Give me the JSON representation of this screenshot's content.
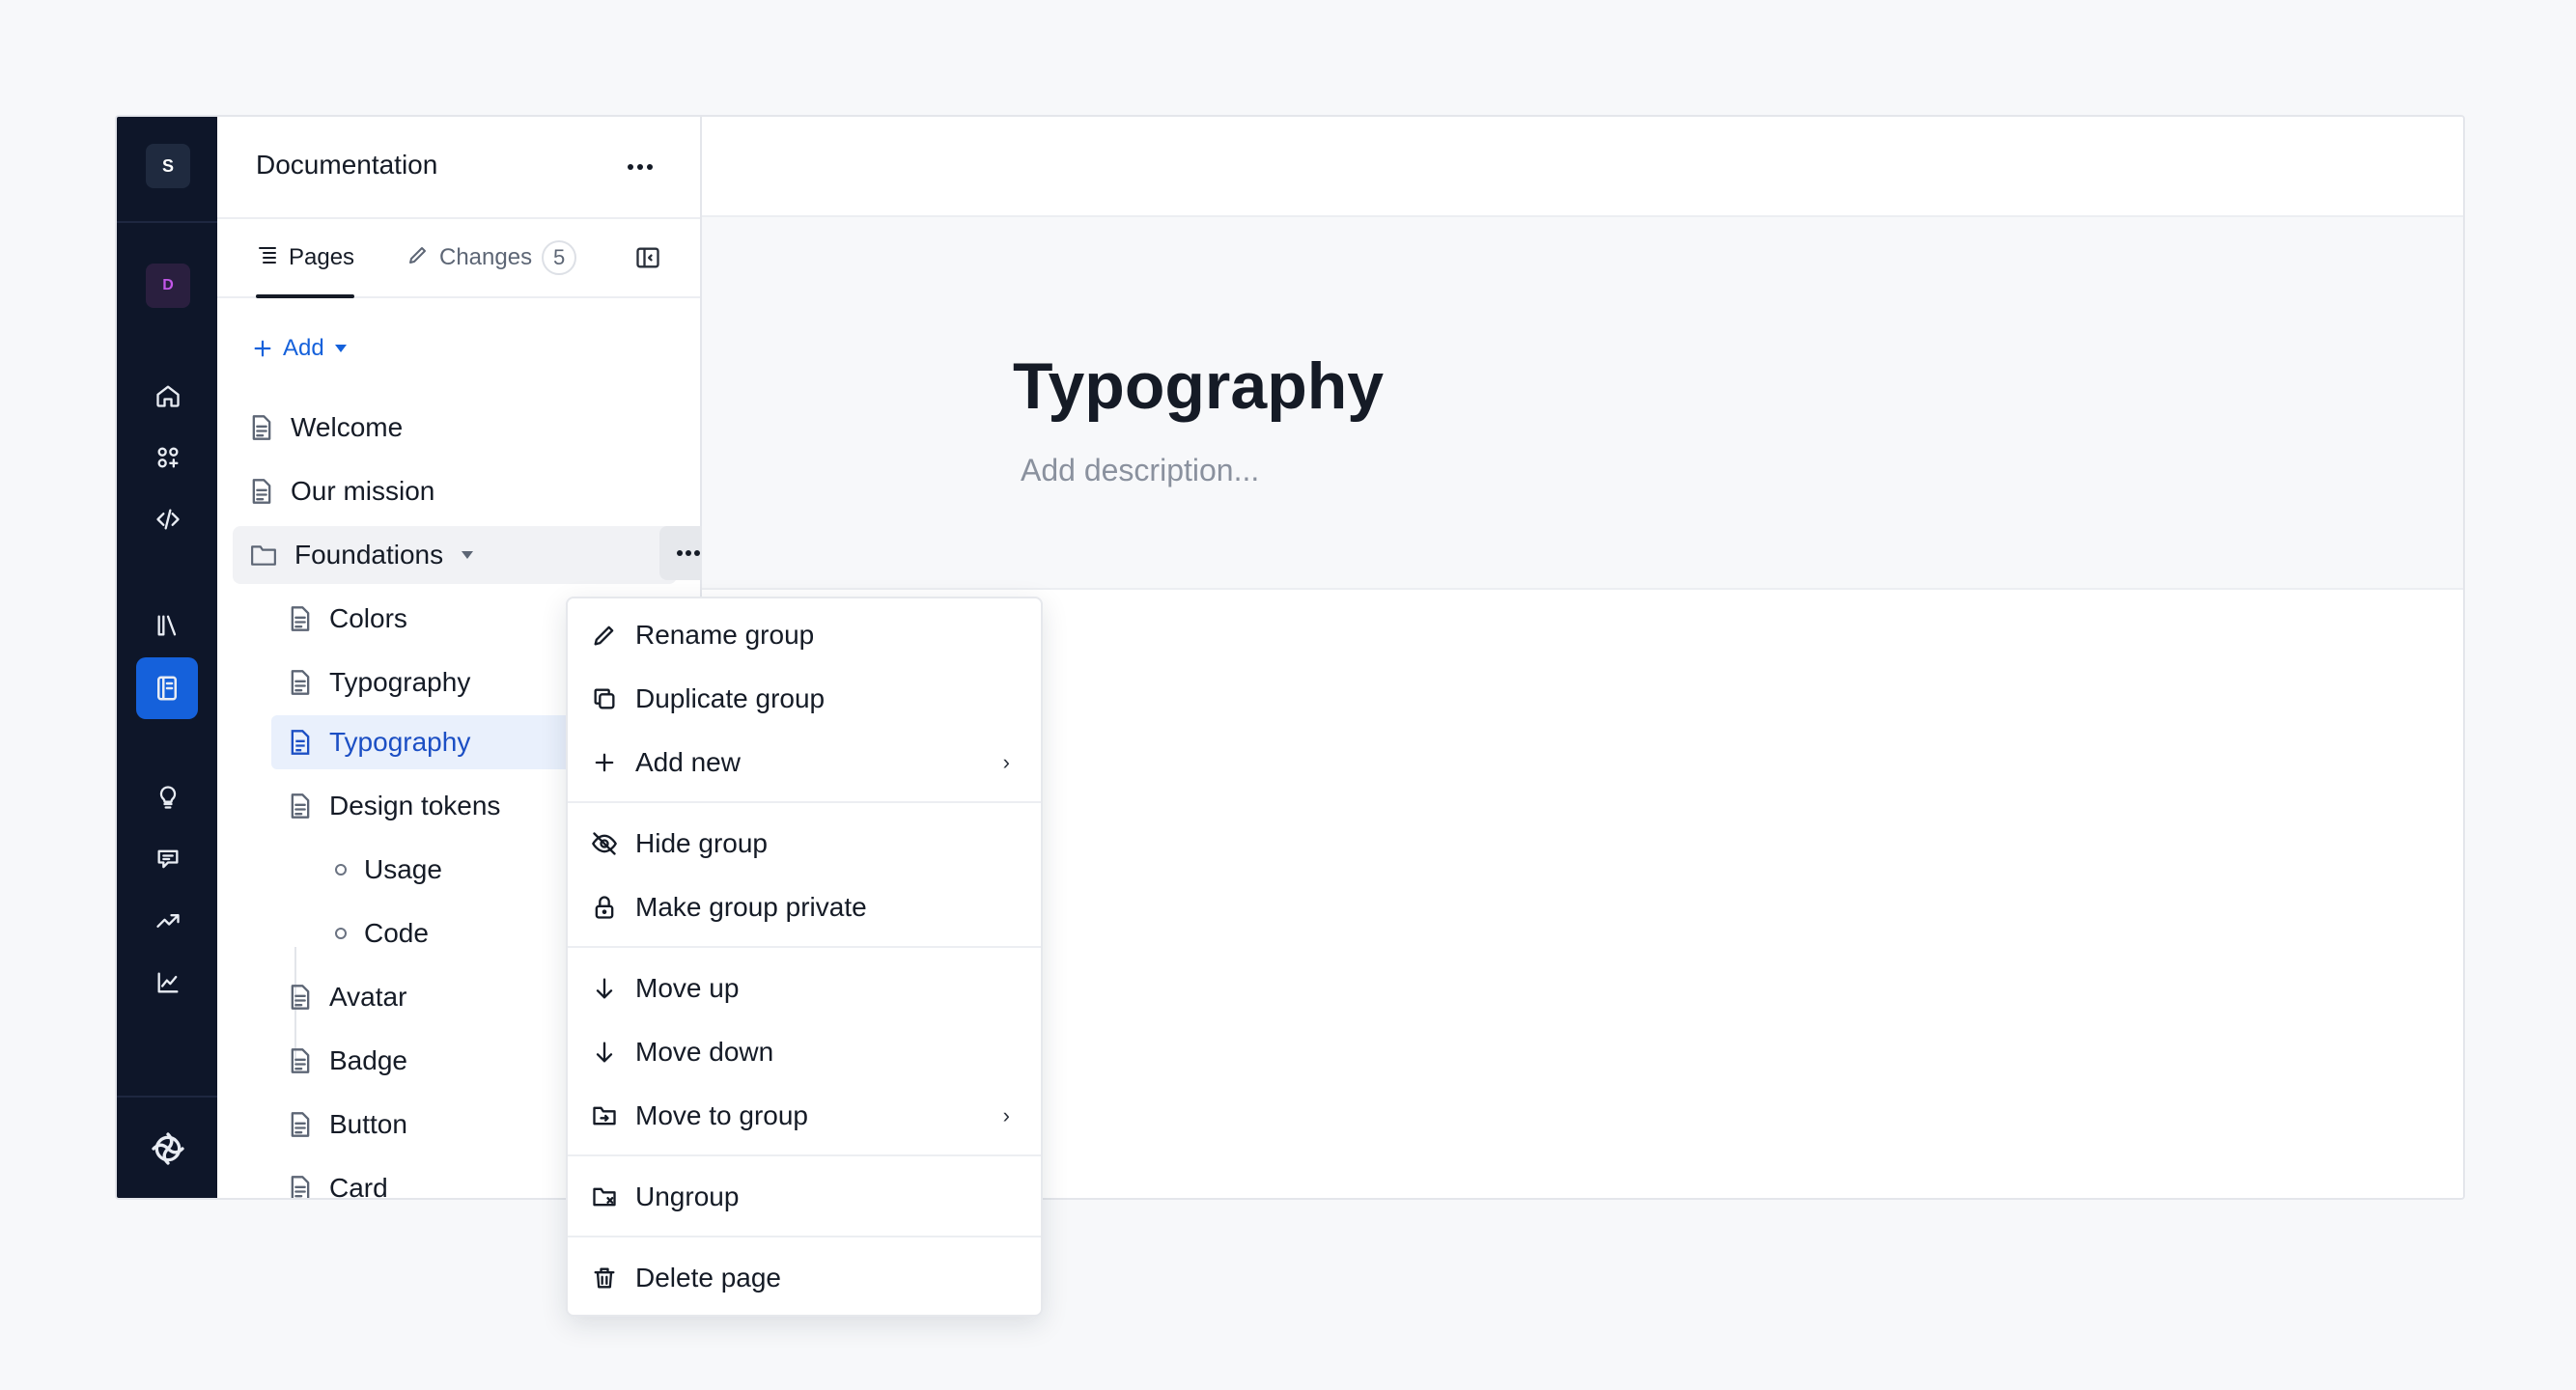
{
  "rail": {
    "workspace_letter": "S",
    "project_letter": "D"
  },
  "sidebar": {
    "title": "Documentation",
    "tabs": [
      {
        "label": "Pages"
      },
      {
        "label": "Changes",
        "count": "5"
      }
    ],
    "add_label": "Add",
    "tree": [
      {
        "label": "Welcome"
      },
      {
        "label": "Our mission"
      },
      {
        "label": "Foundations"
      },
      {
        "label": "Colors"
      },
      {
        "label": "Typography"
      },
      {
        "label": "Typography"
      },
      {
        "label": "Design tokens"
      },
      {
        "label": "Usage"
      },
      {
        "label": "Code"
      },
      {
        "label": "Avatar"
      },
      {
        "label": "Badge"
      },
      {
        "label": "Button"
      },
      {
        "label": "Card"
      }
    ]
  },
  "main": {
    "title": "Typography",
    "description_placeholder": "Add description..."
  },
  "context_menu": {
    "items": [
      {
        "label": "Rename group",
        "icon": "pencil-icon"
      },
      {
        "label": "Duplicate group",
        "icon": "duplicate-icon"
      },
      {
        "label": "Add new",
        "icon": "plus-icon",
        "submenu": true
      },
      {
        "label": "Hide group",
        "icon": "eye-off-icon"
      },
      {
        "label": "Make group private",
        "icon": "lock-icon"
      },
      {
        "label": "Move up",
        "icon": "arrow-down-icon"
      },
      {
        "label": "Move down",
        "icon": "arrow-down-icon"
      },
      {
        "label": "Move to group",
        "icon": "folder-move-icon",
        "submenu": true
      },
      {
        "label": "Ungroup",
        "icon": "folder-x-icon"
      },
      {
        "label": "Delete page",
        "icon": "trash-icon"
      }
    ]
  },
  "colors": {
    "accent": "#1561db",
    "rail_bg": "#0e1629",
    "selected_bg": "#e9f0fc"
  }
}
